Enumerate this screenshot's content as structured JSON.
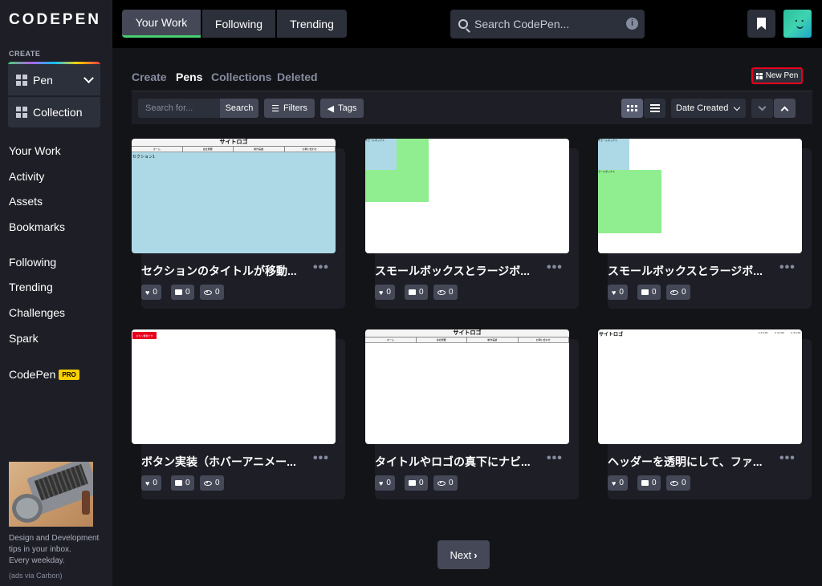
{
  "brand": {
    "name": "CODEPEN"
  },
  "sidebar": {
    "create_label": "CREATE",
    "create_items": [
      {
        "label": "Pen"
      },
      {
        "label": "Collection"
      }
    ],
    "nav_primary": [
      {
        "label": "Your Work"
      },
      {
        "label": "Activity"
      },
      {
        "label": "Assets"
      },
      {
        "label": "Bookmarks"
      }
    ],
    "nav_secondary": [
      {
        "label": "Following"
      },
      {
        "label": "Trending"
      },
      {
        "label": "Challenges"
      },
      {
        "label": "Spark"
      }
    ],
    "codepen_pro": {
      "label": "CodePen",
      "badge": "PRO"
    },
    "ad": {
      "text_lines": [
        "Design and Development",
        "tips in your inbox.",
        "Every weekday."
      ],
      "via": "(ads via Carbon)"
    }
  },
  "header": {
    "tabs": [
      {
        "label": "Your Work",
        "active": true
      },
      {
        "label": "Following",
        "active": false
      },
      {
        "label": "Trending",
        "active": false
      }
    ],
    "search_placeholder": "Search CodePen...",
    "info_icon": "i"
  },
  "subnav": {
    "items": [
      {
        "label": "Create",
        "active": false
      },
      {
        "label": "Pens",
        "active": true
      },
      {
        "label": "Collections",
        "active": false
      },
      {
        "label": "Deleted",
        "active": false
      }
    ],
    "new_pen_label": "New Pen"
  },
  "toolbar": {
    "search_placeholder": "Search for...",
    "search_button": "Search",
    "filters_button": "Filters",
    "tags_button": "Tags",
    "sort_label": "Date Created"
  },
  "thumb_text": {
    "site_logo": "サイトロゴ",
    "menu_items": [
      "ホーム",
      "会社概要",
      "制作実績",
      "お問い合わせ"
    ],
    "section_label": "セクション1",
    "small_box": "スモールボックス",
    "large_box": "ラージボックス",
    "red_button": "ボタン要素です",
    "links": [
      "リスト01",
      "リスト02",
      "リスト03"
    ]
  },
  "pens": [
    {
      "title": "セクションのタイトルが移動...",
      "likes": "0",
      "comments": "0",
      "views": "0"
    },
    {
      "title": "スモールボックスとラージボ...",
      "likes": "0",
      "comments": "0",
      "views": "0"
    },
    {
      "title": "スモールボックスとラージボ...",
      "likes": "0",
      "comments": "0",
      "views": "0"
    },
    {
      "title": "ボタン実装（ホバーアニメー...",
      "likes": "0",
      "comments": "0",
      "views": "0"
    },
    {
      "title": "タイトルやロゴの真下にナビ...",
      "likes": "0",
      "comments": "0",
      "views": "0"
    },
    {
      "title": "ヘッダーを透明にして、ファ...",
      "likes": "0",
      "comments": "0",
      "views": "0"
    }
  ],
  "pagination": {
    "next_label": "Next"
  },
  "colors": {
    "accent": "#47cf73",
    "highlight_border": "#e8001e",
    "pro_badge": "#fcd000"
  }
}
